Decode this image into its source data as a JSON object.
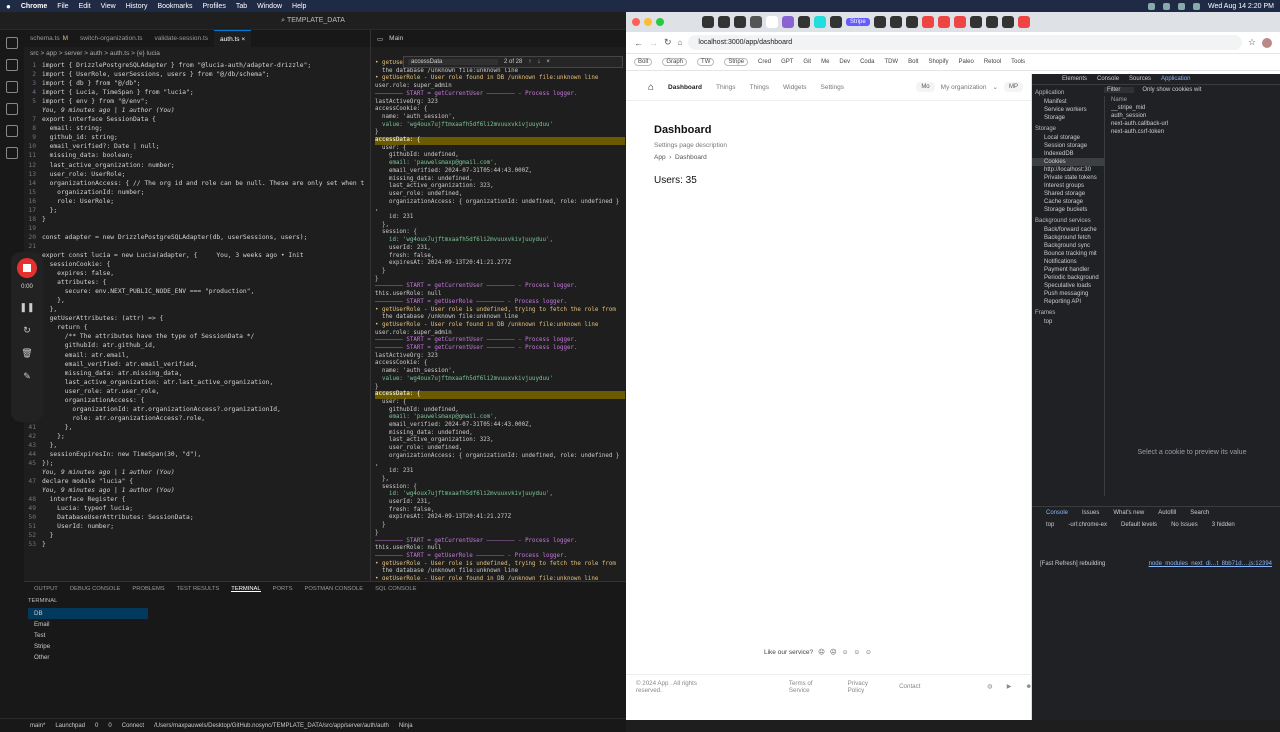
{
  "menubar": {
    "app": "Chrome",
    "items": [
      "File",
      "Edit",
      "View",
      "History",
      "Bookmarks",
      "Profiles",
      "Tab",
      "Window",
      "Help"
    ],
    "clock": "Wed Aug 14  2:20 PM"
  },
  "vscode": {
    "title": "TEMPLATE_DATA",
    "tabs": [
      {
        "label": "schema.ts",
        "mod": "M"
      },
      {
        "label": "switch-organization.ts",
        "mod": ""
      },
      {
        "label": "validate-session.ts",
        "mod": ""
      },
      {
        "label": "auth.ts",
        "mod": ""
      }
    ],
    "breadcrumb": "src > app > server > auth > auth.ts > {e} lucia",
    "recorder_time": "0:00",
    "code": [
      {
        "n": "1",
        "t": "import { DrizzlePostgreSQLAdapter } from \"@lucia-auth/adapter-drizzle\";"
      },
      {
        "n": "2",
        "t": "import { UserRole, userSessions, users } from \"@/db/schema\";"
      },
      {
        "n": "3",
        "t": "import { db } from \"@/db\";"
      },
      {
        "n": "4",
        "t": "import { Lucia, TimeSpan } from \"lucia\";"
      },
      {
        "n": "5",
        "t": "import { env } from \"@/env\";"
      },
      {
        "n": "",
        "t": "You, 9 minutes ago | 1 author (You)",
        "blame": true
      },
      {
        "n": "7",
        "t": "export interface SessionData {"
      },
      {
        "n": "8",
        "t": "  email: string;"
      },
      {
        "n": "9",
        "t": "  github_id: string;"
      },
      {
        "n": "10",
        "t": "  email_verified?: Date | null;"
      },
      {
        "n": "11",
        "t": "  missing_data: boolean;"
      },
      {
        "n": "12",
        "t": "  last_active_organization: number;"
      },
      {
        "n": "13",
        "t": "  user_role: UserRole;"
      },
      {
        "n": "14",
        "t": "  organizationAccess: { // The org id and role can be null. These are only set when t"
      },
      {
        "n": "15",
        "t": "    organizationId: number;"
      },
      {
        "n": "16",
        "t": "    role: UserRole;"
      },
      {
        "n": "17",
        "t": "  };"
      },
      {
        "n": "18",
        "t": "}"
      },
      {
        "n": "19",
        "t": ""
      },
      {
        "n": "20",
        "t": "const adapter = new DrizzlePostgreSQLAdapter(db, userSessions, users);"
      },
      {
        "n": "21",
        "t": ""
      },
      {
        "n": "22",
        "t": "export const lucia = new Lucia(adapter, {     You, 3 weeks ago • Init"
      },
      {
        "n": "23",
        "t": "  sessionCookie: {"
      },
      {
        "n": "24",
        "t": "    expires: false,"
      },
      {
        "n": "25",
        "t": "    attributes: {"
      },
      {
        "n": "26",
        "t": "      secure: env.NEXT_PUBLIC_NODE_ENV === \"production\","
      },
      {
        "n": "27",
        "t": "    },"
      },
      {
        "n": "28",
        "t": "  },"
      },
      {
        "n": "29",
        "t": "  getUserAttributes: (attr) => {"
      },
      {
        "n": "30",
        "t": "    return {"
      },
      {
        "n": "31",
        "t": "      /** The attributes have the type of SessionData */"
      },
      {
        "n": "32",
        "t": "      githubId: atr.github_id,"
      },
      {
        "n": "33",
        "t": "      email: atr.email,"
      },
      {
        "n": "34",
        "t": "      email_verified: atr.email_verified,"
      },
      {
        "n": "35",
        "t": "      missing_data: atr.missing_data,"
      },
      {
        "n": "36",
        "t": "      last_active_organization: atr.last_active_organization,"
      },
      {
        "n": "37",
        "t": "      user_role: atr.user_role,"
      },
      {
        "n": "38",
        "t": "      organizationAccess: {"
      },
      {
        "n": "39",
        "t": "        organizationId: atr.organizationAccess?.organizationId,"
      },
      {
        "n": "40",
        "t": "        role: atr.organizationAccess?.role,"
      },
      {
        "n": "41",
        "t": "      },"
      },
      {
        "n": "42",
        "t": "    };"
      },
      {
        "n": "43",
        "t": "  },"
      },
      {
        "n": "44",
        "t": "  sessionExpiresIn: new TimeSpan(30, \"d\"),"
      },
      {
        "n": "45",
        "t": "});"
      },
      {
        "n": "",
        "t": "You, 9 minutes ago | 1 author (You)",
        "blame": true
      },
      {
        "n": "47",
        "t": "declare module \"lucia\" {"
      },
      {
        "n": "",
        "t": "You, 9 minutes ago | 1 author (You)",
        "blame": true
      },
      {
        "n": "48",
        "t": "  interface Register {"
      },
      {
        "n": "49",
        "t": "    Lucia: typeof lucia;"
      },
      {
        "n": "50",
        "t": "    DatabaseUserAttributes: SessionData;"
      },
      {
        "n": "51",
        "t": "    UserId: number;"
      },
      {
        "n": "52",
        "t": "  }"
      },
      {
        "n": "53",
        "t": "}"
      }
    ],
    "term2": {
      "title": "Main",
      "find_query": "accessData",
      "find_count": "2 of 28"
    },
    "log": [
      {
        "c": "warn",
        "t": "• getUserRole - User role is undefined, trying to fetch the role from"
      },
      {
        "c": "lg",
        "t": "  the database /unknown file:unknown line"
      },
      {
        "c": "warn",
        "t": "• getUserRole - User role found in DB /unknown file:unknown line"
      },
      {
        "c": "lg",
        "t": "user.role: super_admin"
      },
      {
        "c": "mag",
        "t": "———————— START = getCurrentUser ———————— - Process logger."
      },
      {
        "c": "lg",
        "t": "lastActiveOrg: 323"
      },
      {
        "c": "lg",
        "t": "accessCookie: {"
      },
      {
        "c": "lg",
        "t": "  name: 'auth_session',"
      },
      {
        "c": "green",
        "t": "  value: 'wg4oux7ujftmxaafh5df6li2mvuuxvkivjuuyduu'"
      },
      {
        "c": "lg",
        "t": "}"
      },
      {
        "c": "hl",
        "t": "accessData: {"
      },
      {
        "c": "lg",
        "t": "  user: {"
      },
      {
        "c": "lg",
        "t": "    githubId: undefined,"
      },
      {
        "c": "green",
        "t": "    email: 'pauwelsmaxp@gmail.com',"
      },
      {
        "c": "lg",
        "t": "    email_verified: 2024-07-31T05:44:43.000Z,"
      },
      {
        "c": "lg",
        "t": "    missing_data: undefined,"
      },
      {
        "c": "lg",
        "t": "    last_active_organization: 323,"
      },
      {
        "c": "lg",
        "t": "    user_role: undefined,"
      },
      {
        "c": "lg",
        "t": "    organizationAccess: { organizationId: undefined, role: undefined }"
      },
      {
        "c": "lg",
        "t": ","
      },
      {
        "c": "lg",
        "t": "    id: 231"
      },
      {
        "c": "lg",
        "t": "  },"
      },
      {
        "c": "lg",
        "t": "  session: {"
      },
      {
        "c": "green",
        "t": "    id: 'wg4oux7ujftmxaafh5df6li2mvuuxvkivjuuyduu',"
      },
      {
        "c": "lg",
        "t": "    userId: 231,"
      },
      {
        "c": "lg",
        "t": "    fresh: false,"
      },
      {
        "c": "lg",
        "t": "    expiresAt: 2024-09-13T20:41:21.277Z"
      },
      {
        "c": "lg",
        "t": "  }"
      },
      {
        "c": "lg",
        "t": "}"
      },
      {
        "c": "mag",
        "t": "———————— START = getCurrentUser ———————— - Process logger."
      },
      {
        "c": "lg",
        "t": "this.userRole: null"
      },
      {
        "c": "mag",
        "t": "———————— START = getUserRole ———————— - Process logger."
      },
      {
        "c": "warn",
        "t": "• getUserRole - User role is undefined, trying to fetch the role from"
      },
      {
        "c": "lg",
        "t": "  the database /unknown file:unknown line"
      },
      {
        "c": "warn",
        "t": "• getUserRole - User role found in DB /unknown file:unknown line"
      },
      {
        "c": "lg",
        "t": "user.role: super_admin"
      },
      {
        "c": "mag",
        "t": "———————— START = getCurrentUser ———————— - Process logger."
      },
      {
        "c": "mag",
        "t": "———————— START = getCurrentUser ———————— - Process logger."
      },
      {
        "c": "lg",
        "t": "lastActiveOrg: 323"
      },
      {
        "c": "lg",
        "t": "accessCookie: {"
      },
      {
        "c": "lg",
        "t": "  name: 'auth_session',"
      },
      {
        "c": "green",
        "t": "  value: 'wg4oux7ujftmxaafh5df6li2mvuuxvkivjuuyduu'"
      },
      {
        "c": "lg",
        "t": "}"
      },
      {
        "c": "hl",
        "t": "accessData: {"
      },
      {
        "c": "lg",
        "t": "  user: {"
      },
      {
        "c": "lg",
        "t": "    githubId: undefined,"
      },
      {
        "c": "green",
        "t": "    email: 'pauwelsmaxp@gmail.com',"
      },
      {
        "c": "lg",
        "t": "    email_verified: 2024-07-31T05:44:43.000Z,"
      },
      {
        "c": "lg",
        "t": "    missing_data: undefined,"
      },
      {
        "c": "lg",
        "t": "    last_active_organization: 323,"
      },
      {
        "c": "lg",
        "t": "    user_role: undefined,"
      },
      {
        "c": "lg",
        "t": "    organizationAccess: { organizationId: undefined, role: undefined }"
      },
      {
        "c": "lg",
        "t": ","
      },
      {
        "c": "lg",
        "t": "    id: 231"
      },
      {
        "c": "lg",
        "t": "  },"
      },
      {
        "c": "lg",
        "t": "  session: {"
      },
      {
        "c": "green",
        "t": "    id: 'wg4oux7ujftmxaafh5df6li2mvuuxvkivjuuyduu',"
      },
      {
        "c": "lg",
        "t": "    userId: 231,"
      },
      {
        "c": "lg",
        "t": "    fresh: false,"
      },
      {
        "c": "lg",
        "t": "    expiresAt: 2024-09-13T20:41:21.277Z"
      },
      {
        "c": "lg",
        "t": "  }"
      },
      {
        "c": "lg",
        "t": "}"
      },
      {
        "c": "mag",
        "t": "———————— START = getCurrentUser ———————— - Process logger."
      },
      {
        "c": "lg",
        "t": "this.userRole: null"
      },
      {
        "c": "mag",
        "t": "———————— START = getUserRole ———————— - Process logger."
      },
      {
        "c": "warn",
        "t": "• getUserRole - User role is undefined, trying to fetch the role from"
      },
      {
        "c": "lg",
        "t": "  the database /unknown file:unknown line"
      },
      {
        "c": "warn",
        "t": "• getUserRole - User role found in DB /unknown file:unknown line"
      },
      {
        "c": "lg",
        "t": "user.role: super_admin"
      },
      {
        "c": "lg",
        "t": " POST /app/dashboard 200 in 46ms"
      }
    ],
    "panel_tabs": [
      "OUTPUT",
      "DEBUG CONSOLE",
      "PROBLEMS",
      "TEST RESULTS",
      "TERMINAL",
      "PORTS",
      "POSTMAN CONSOLE",
      "SQL CONSOLE"
    ],
    "terminal_header": "TERMINAL",
    "terminals": [
      "DB",
      "Email",
      "Test",
      "Stripe",
      "Other"
    ],
    "status": {
      "branch": "main*",
      "launch": "Launchpad",
      "errors": "0",
      "warnings": "0",
      "connect": "Connect",
      "path": "/Users/maxpauwels/Desktop/GitHub.nosync/TEMPLATE_DATA/src/app/server/auth/auth",
      "ninja": "Ninja"
    }
  },
  "chrome": {
    "tab_title": "Stripe",
    "url": "localhost:3000/app/dashboard",
    "bookmarks": [
      "Bolt",
      "Graph",
      "TW",
      "Stripe",
      "Cred",
      "GPT",
      "Git",
      "Me",
      "Dev",
      "Coda",
      "TDW",
      "Bolt",
      "Shopify",
      "Paleo",
      "Retool",
      "Tools"
    ],
    "app": {
      "nav": [
        "Dashboard",
        "Things",
        "Things",
        "Widgets",
        "Settings"
      ],
      "org_initials": "Mo",
      "org_name": "My organization",
      "user_initials": "MP",
      "title": "Dashboard",
      "description": "Settings page description",
      "crumb_root": "App",
      "crumb_current": "Dashboard",
      "users": "Users: 35",
      "feedback": "Like our service?",
      "footer_copy": "© 2024 App . All rights reserved.",
      "footer_links": [
        "Terms of Service",
        "Privacy Policy",
        "Contact"
      ]
    },
    "devtools": {
      "tabs": [
        "Elements",
        "Console",
        "Sources",
        "Application"
      ],
      "filter_placeholder": "Filter",
      "only_cookies": "Only show cookies wit",
      "app_section": "Application",
      "app_items": [
        "Manifest",
        "Service workers",
        "Storage"
      ],
      "storage_section": "Storage",
      "storage_items": [
        "Local storage",
        "Session storage",
        "IndexedDB",
        "Cookies",
        "http://localhost:30",
        "Private state tokens",
        "Interest groups",
        "Shared storage",
        "Cache storage",
        "Storage buckets"
      ],
      "bg_section": "Background services",
      "bg_items": [
        "Back/forward cache",
        "Background fetch",
        "Background sync",
        "Bounce tracking mit",
        "Notifications",
        "Payment handler",
        "Periodic background",
        "Speculative loads",
        "Push messaging",
        "Reporting API"
      ],
      "frames_section": "Frames",
      "frames_items": [
        "top"
      ],
      "cookie_header": "Name",
      "cookies": [
        "__stripe_mid",
        "auth_session",
        "next-auth.callback-url",
        "next-auth.csrf-token"
      ],
      "preview_text": "Select a cookie to preview its value",
      "console_tabs": [
        "Console",
        "Issues",
        "What's new",
        "Autofill",
        "Search"
      ],
      "console_context": "top",
      "console_filter": "-url:chrome-ex",
      "levels": "Default levels",
      "issues": "No Issues",
      "hidden": "3 hidden",
      "log_text": "[Fast Refresh] rebuilding",
      "log_link": "node_modules_next_di…t_8bb71d….js:12394"
    }
  }
}
